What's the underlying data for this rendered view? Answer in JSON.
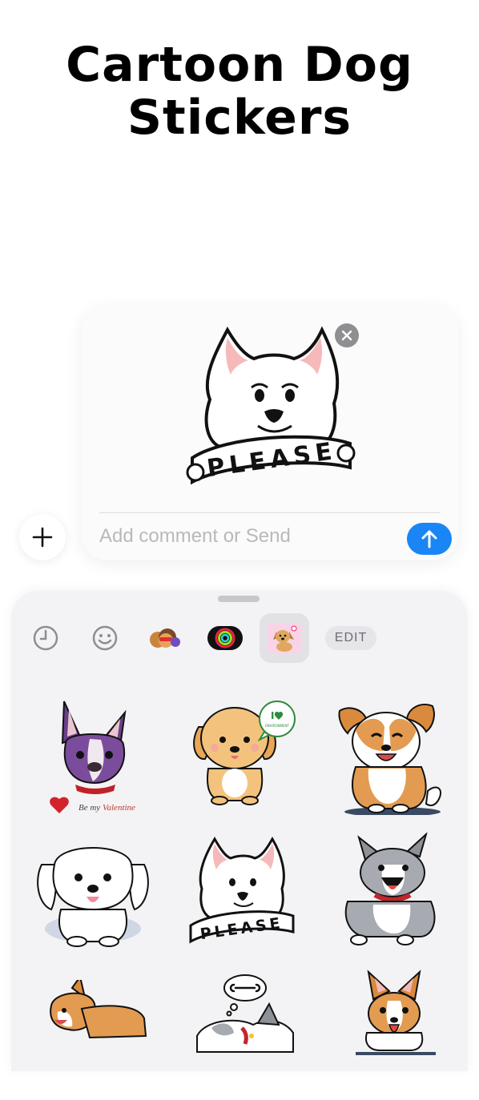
{
  "header": {
    "title_line1": "Cartoon Dog",
    "title_line2": "Stickers"
  },
  "compose": {
    "preview_sticker_text": "PLEASE",
    "comment_placeholder": "Add comment or Send"
  },
  "drawer": {
    "tabs": [
      {
        "icon": "recent-clock-icon"
      },
      {
        "icon": "emoji-smiley-icon"
      },
      {
        "icon": "memoji-app-icon"
      },
      {
        "icon": "activity-rings-icon"
      },
      {
        "icon": "dog-sticker-pack-icon",
        "selected": true
      }
    ],
    "edit_label": "EDIT",
    "stickers": [
      {
        "name": "french-bulldog-valentine",
        "text_be_my": "Be my",
        "text_valentine": "Valentine"
      },
      {
        "name": "golden-puppy-i-love",
        "bubble_text": "I",
        "bubble_small": "ENVIRONMENT"
      },
      {
        "name": "corgi-sitting"
      },
      {
        "name": "maltese-puppy"
      },
      {
        "name": "samoyed-please",
        "text": "PLEASE"
      },
      {
        "name": "grey-corgi-happy"
      },
      {
        "name": "corgi-lying"
      },
      {
        "name": "sleeping-dog-dream"
      },
      {
        "name": "corgi-tongue"
      }
    ]
  },
  "colors": {
    "accent": "#1a86f6",
    "drawer_bg": "#f3f3f5",
    "heart": "#d3242b",
    "valentine_red": "#c0392b"
  }
}
